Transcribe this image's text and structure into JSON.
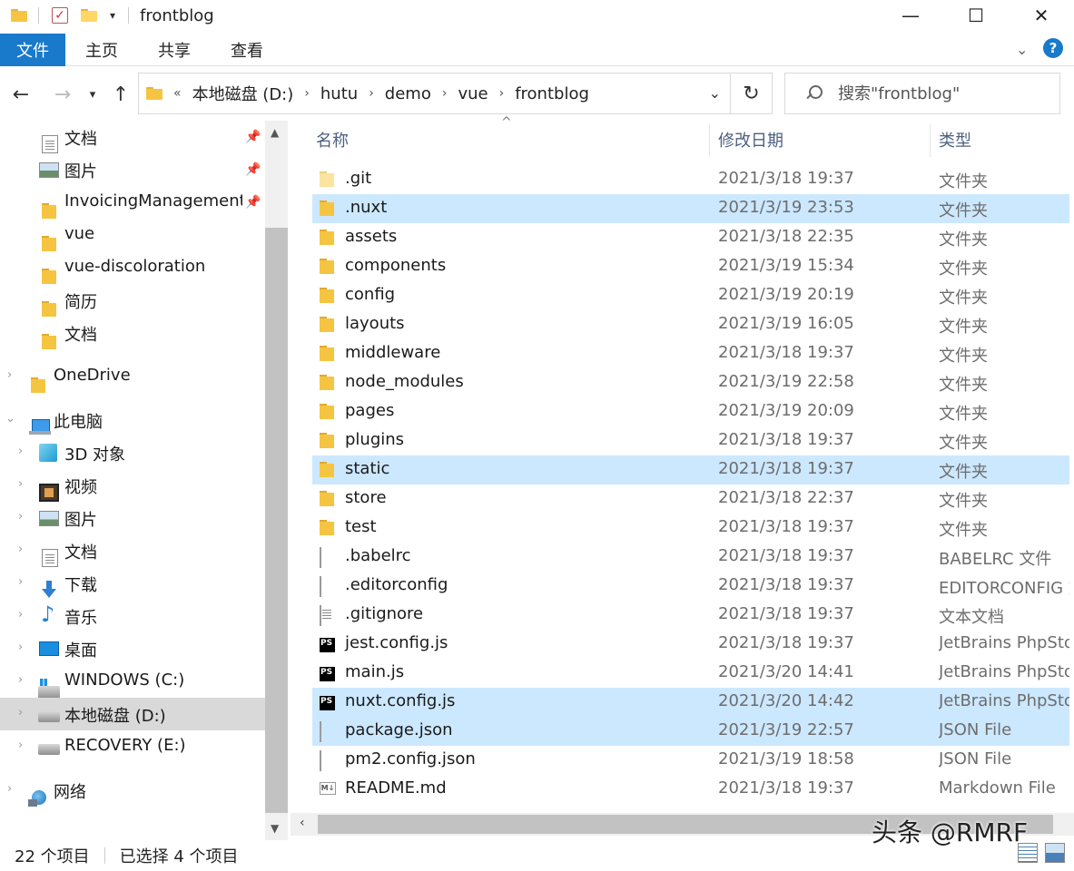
{
  "window": {
    "title": "frontblog"
  },
  "ribbon": {
    "tabs": [
      "文件",
      "主页",
      "共享",
      "查看"
    ]
  },
  "address": {
    "prefix": "«",
    "crumbs": [
      "本地磁盘 (D:)",
      "hutu",
      "demo",
      "vue",
      "frontblog"
    ]
  },
  "search": {
    "placeholder": "搜索\"frontblog\""
  },
  "sidebar": {
    "items": [
      {
        "label": "文档",
        "icon": "document-icon",
        "pinned": true
      },
      {
        "label": "图片",
        "icon": "picture-icon",
        "pinned": true
      },
      {
        "label": "InvoicingManagement",
        "icon": "folder-icon",
        "pinned": true
      },
      {
        "label": "vue",
        "icon": "folder-icon"
      },
      {
        "label": "vue-discoloration",
        "icon": "folder-icon"
      },
      {
        "label": "简历",
        "icon": "folder-icon"
      },
      {
        "label": "文档",
        "icon": "folder-icon"
      },
      {
        "label": "OneDrive",
        "icon": "folder-icon"
      },
      {
        "label": "此电脑",
        "icon": "pc-icon"
      },
      {
        "label": "3D 对象",
        "icon": "cube-icon"
      },
      {
        "label": "视频",
        "icon": "video-icon"
      },
      {
        "label": "图片",
        "icon": "picture-icon"
      },
      {
        "label": "文档",
        "icon": "document-icon"
      },
      {
        "label": "下载",
        "icon": "download-icon"
      },
      {
        "label": "音乐",
        "icon": "music-icon"
      },
      {
        "label": "桌面",
        "icon": "desktop-icon"
      },
      {
        "label": "WINDOWS (C:)",
        "icon": "windows-drive-icon"
      },
      {
        "label": "本地磁盘 (D:)",
        "icon": "drive-icon",
        "selected": true
      },
      {
        "label": "RECOVERY (E:)",
        "icon": "drive-icon"
      },
      {
        "label": "网络",
        "icon": "network-icon"
      }
    ]
  },
  "columns": {
    "name": "名称",
    "date": "修改日期",
    "type": "类型"
  },
  "files": [
    {
      "name": ".git",
      "date": "2021/3/18 19:37",
      "type": "文件夹",
      "icon": "folder-icon",
      "hidden": true
    },
    {
      "name": ".nuxt",
      "date": "2021/3/19 23:53",
      "type": "文件夹",
      "icon": "folder-icon",
      "selected": true
    },
    {
      "name": "assets",
      "date": "2021/3/18 22:35",
      "type": "文件夹",
      "icon": "folder-icon"
    },
    {
      "name": "components",
      "date": "2021/3/19 15:34",
      "type": "文件夹",
      "icon": "folder-icon"
    },
    {
      "name": "config",
      "date": "2021/3/19 20:19",
      "type": "文件夹",
      "icon": "folder-icon"
    },
    {
      "name": "layouts",
      "date": "2021/3/19 16:05",
      "type": "文件夹",
      "icon": "folder-icon"
    },
    {
      "name": "middleware",
      "date": "2021/3/18 19:37",
      "type": "文件夹",
      "icon": "folder-icon"
    },
    {
      "name": "node_modules",
      "date": "2021/3/19 22:58",
      "type": "文件夹",
      "icon": "folder-icon"
    },
    {
      "name": "pages",
      "date": "2021/3/19 20:09",
      "type": "文件夹",
      "icon": "folder-icon"
    },
    {
      "name": "plugins",
      "date": "2021/3/18 19:37",
      "type": "文件夹",
      "icon": "folder-icon"
    },
    {
      "name": "static",
      "date": "2021/3/18 19:37",
      "type": "文件夹",
      "icon": "folder-icon",
      "selected": true
    },
    {
      "name": "store",
      "date": "2021/3/18 22:37",
      "type": "文件夹",
      "icon": "folder-icon"
    },
    {
      "name": "test",
      "date": "2021/3/18 19:37",
      "type": "文件夹",
      "icon": "folder-icon"
    },
    {
      "name": ".babelrc",
      "date": "2021/3/18 19:37",
      "type": "BABELRC 文件",
      "icon": "file-icon"
    },
    {
      "name": ".editorconfig",
      "date": "2021/3/18 19:37",
      "type": "EDITORCONFIG 文件",
      "icon": "file-icon"
    },
    {
      "name": ".gitignore",
      "date": "2021/3/18 19:37",
      "type": "文本文档",
      "icon": "text-file-icon"
    },
    {
      "name": "jest.config.js",
      "date": "2021/3/18 19:37",
      "type": "JetBrains PhpStorm",
      "icon": "phpstorm-icon"
    },
    {
      "name": "main.js",
      "date": "2021/3/20 14:41",
      "type": "JetBrains PhpStorm",
      "icon": "phpstorm-icon"
    },
    {
      "name": "nuxt.config.js",
      "date": "2021/3/20 14:42",
      "type": "JetBrains PhpStorm",
      "icon": "phpstorm-icon",
      "selected": true
    },
    {
      "name": "package.json",
      "date": "2021/3/19 22:57",
      "type": "JSON File",
      "icon": "file-icon",
      "selected": true
    },
    {
      "name": "pm2.config.json",
      "date": "2021/3/19 18:58",
      "type": "JSON File",
      "icon": "file-icon"
    },
    {
      "name": "README.md",
      "date": "2021/3/18 19:37",
      "type": "Markdown File",
      "icon": "markdown-icon"
    }
  ],
  "status": {
    "count": "22 个项目",
    "selected": "已选择 4 个项目"
  },
  "watermark": "头条 @RMRF",
  "colors": {
    "accent": "#1979ca",
    "selection": "#cce8ff",
    "sidebar_selection": "#d9d9d9",
    "header_text": "#4d6082"
  }
}
